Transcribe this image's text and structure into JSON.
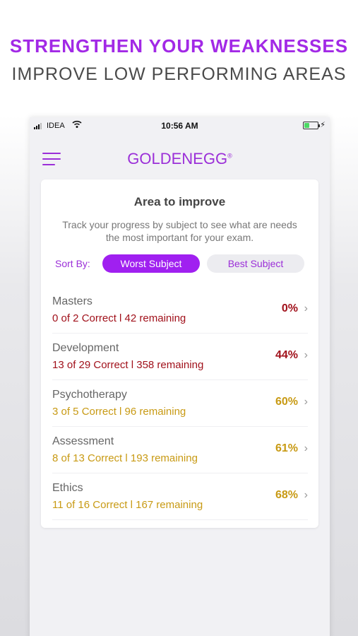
{
  "promo": {
    "title": "STRENGTHEN YOUR WEAKNESSES",
    "subtitle": "IMPROVE LOW PERFORMING AREAS"
  },
  "status_bar": {
    "carrier": "IDEA",
    "time": "10:56 AM",
    "battery_level": 0.4
  },
  "header": {
    "logo": "GOLDENEGG",
    "logo_mark": "®"
  },
  "card": {
    "title": "Area to improve",
    "description": "Track your progress by subject to see what are needs the most important for your exam.",
    "sort_label": "Sort By:",
    "sort_worst": "Worst Subject",
    "sort_best": "Best Subject"
  },
  "colors": {
    "accent": "#a020f0",
    "low": "#a1111b",
    "mid": "#c89a14"
  },
  "subjects": [
    {
      "name": "Masters",
      "stats": "0 of 2  Correct l 42 remaining",
      "percent": "0%",
      "level": "low"
    },
    {
      "name": "Development",
      "stats": "13 of 29  Correct l 358 remaining",
      "percent": "44%",
      "level": "low"
    },
    {
      "name": "Psychotherapy",
      "stats": "3 of 5  Correct l 96 remaining",
      "percent": "60%",
      "level": "mid"
    },
    {
      "name": "Assessment",
      "stats": "8 of 13  Correct l 193 remaining",
      "percent": "61%",
      "level": "mid"
    },
    {
      "name": "Ethics",
      "stats": "11 of 16  Correct l 167 remaining",
      "percent": "68%",
      "level": "mid"
    }
  ]
}
